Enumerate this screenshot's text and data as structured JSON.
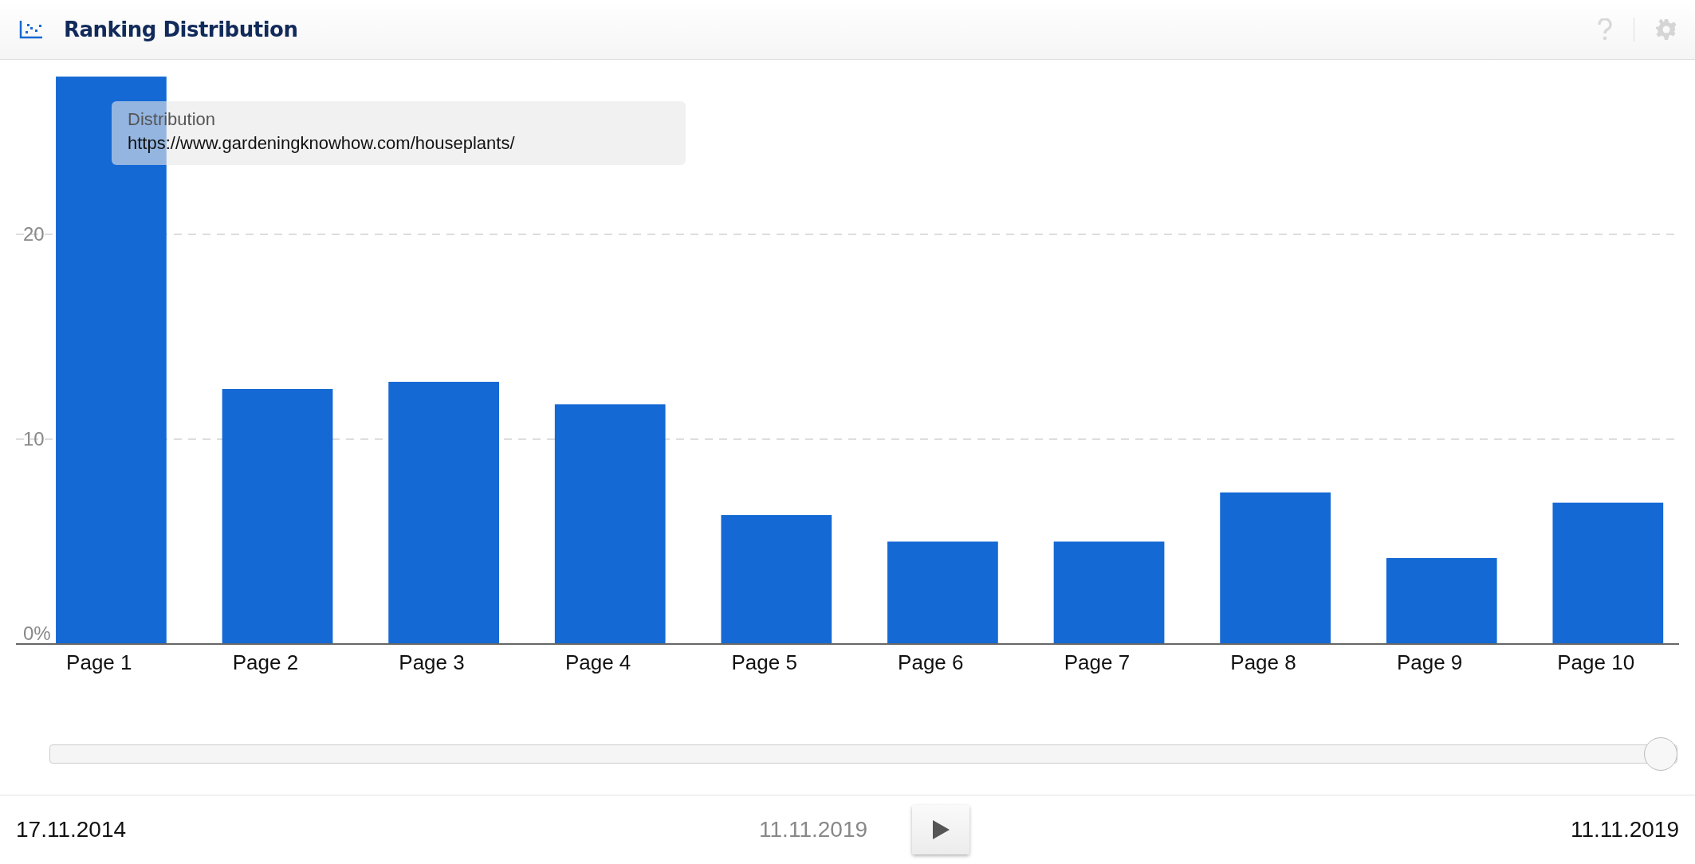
{
  "header": {
    "title": "Ranking Distribution"
  },
  "chart": {
    "chart_data": {
      "type": "bar",
      "categories": [
        "Page 1",
        "Page 2",
        "Page 3",
        "Page 4",
        "Page 5",
        "Page 6",
        "Page 7",
        "Page 8",
        "Page 9",
        "Page 10"
      ],
      "series": [
        {
          "color": "#1469d4",
          "values": [
            27.7,
            12.45,
            12.8,
            11.7,
            6.3,
            5.0,
            5.0,
            7.4,
            4.2,
            6.9
          ]
        }
      ],
      "ylim": [
        0,
        31.4
      ],
      "yticks": [
        {
          "value": 0,
          "label": "0%"
        },
        {
          "value": 10,
          "label": "10"
        },
        {
          "value": 20,
          "label": "20"
        }
      ]
    },
    "tooltip": {
      "label": "Distribution",
      "url": "https://www.gardeningknowhow.com/houseplants/"
    }
  },
  "timeline": {
    "level": 1,
    "start_date": "17.11.2014",
    "current_date": "11.11.2019",
    "end_date": "11.11.2019"
  }
}
